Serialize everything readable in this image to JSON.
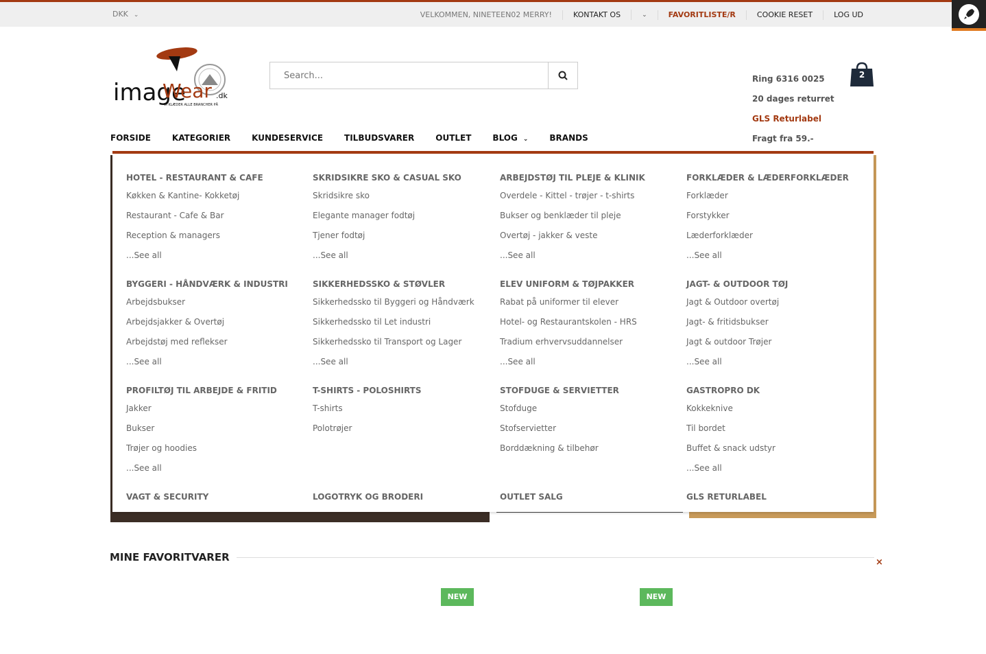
{
  "topbar": {
    "currency": "DKK",
    "welcome": "VELKOMMEN, NINETEEN02 MERRY!",
    "contact": "KONTAKT OS",
    "favorites": "FAVORITLISTE/R",
    "cookie_reset": "COOKIE RESET",
    "logout": "LOG UD"
  },
  "logo": {
    "brand_a": "image",
    "brand_b": "Wear",
    "tld": ".dk",
    "tagline": "VI KLÆDER ALLE BRANCHER PÅ"
  },
  "search": {
    "placeholder": "Search..."
  },
  "info": {
    "phone": "Ring 6316 0025",
    "returns": "20 dages returret",
    "gls": "GLS Returlabel",
    "freight": "Fragt fra 59.-"
  },
  "cart": {
    "count": "2"
  },
  "nav": {
    "items": [
      "FORSIDE",
      "KATEGORIER",
      "KUNDESERVICE",
      "TILBUDSVARER",
      "OUTLET",
      "BLOG",
      "BRANDS"
    ]
  },
  "mega": {
    "groups": [
      {
        "title": "HOTEL - RESTAURANT & CAFE",
        "links": [
          "Køkken & Kantine- Kokketøj",
          "Restaurant - Cafe & Bar",
          "Reception & managers"
        ],
        "see_all": "...See all"
      },
      {
        "title": "SKRIDSIKRE SKO & CASUAL SKO",
        "links": [
          "Skridsikre sko",
          "Elegante manager fodtøj",
          "Tjener fodtøj"
        ],
        "see_all": "...See all"
      },
      {
        "title": "ARBEJDSTØJ TIL PLEJE & KLINIK",
        "links": [
          "Overdele - Kittel - trøjer - t-shirts",
          "Bukser og benklæder til pleje",
          "Overtøj - jakker & veste"
        ],
        "see_all": "...See all"
      },
      {
        "title": "FORKLÆDER & LÆDERFORKLÆDER",
        "links": [
          "Forklæder",
          "Forstykker",
          "Læderforklæder"
        ],
        "see_all": "...See all"
      },
      {
        "title": "BYGGERI - HÅNDVÆRK & INDUSTRI",
        "links": [
          "Arbejdsbukser",
          "Arbejdsjakker & Overtøj",
          "Arbejdstøj med reflekser"
        ],
        "see_all": "...See all"
      },
      {
        "title": "SIKKERHEDSSKO & STØVLER",
        "links": [
          "Sikkerhedssko til Byggeri og Håndværk",
          "Sikkerhedssko til Let industri",
          "Sikkerhedssko til Transport og Lager"
        ],
        "see_all": "...See all"
      },
      {
        "title": "ELEV UNIFORM & TØJPAKKER",
        "links": [
          "Rabat på uniformer til elever",
          "Hotel- og Restaurantskolen - HRS",
          "Tradium erhvervsuddannelser"
        ],
        "see_all": "...See all"
      },
      {
        "title": "JAGT- & OUTDOOR TØJ",
        "links": [
          "Jagt & Outdoor overtøj",
          "Jagt- & fritidsbukser",
          "Jagt & outdoor Trøjer"
        ],
        "see_all": "...See all"
      },
      {
        "title": "PROFILTØJ TIL ARBEJDE & FRITID",
        "links": [
          "Jakker",
          "Bukser",
          "Trøjer og hoodies"
        ],
        "see_all": "...See all"
      },
      {
        "title": "T-SHIRTS - POLOSHIRTS",
        "links": [
          "T-shirts",
          "Polotrøjer"
        ],
        "see_all": ""
      },
      {
        "title": "STOFDUGE & SERVIETTER",
        "links": [
          "Stofduge",
          "Stofservietter",
          "Borddækning & tilbehør"
        ],
        "see_all": ""
      },
      {
        "title": "GASTROPRO DK",
        "links": [
          "Kokkeknive",
          "Til bordet",
          "Buffet & snack udstyr"
        ],
        "see_all": "...See all"
      },
      {
        "title": "VAGT & SECURITY",
        "links": [],
        "see_all": ""
      },
      {
        "title": "LOGOTRYK OG BRODERI",
        "links": [],
        "see_all": ""
      },
      {
        "title": "OUTLET SALG",
        "links": [],
        "see_all": ""
      },
      {
        "title": "GLS RETURLABEL",
        "links": [],
        "see_all": ""
      }
    ]
  },
  "favorites_section": {
    "title": "MINE FAVORITVARER",
    "close": "×",
    "badges": [
      "NEW",
      "NEW"
    ]
  },
  "colors": {
    "accent": "#a33a12",
    "badge": "#5cb85c",
    "cart": "#1e2a3a"
  }
}
